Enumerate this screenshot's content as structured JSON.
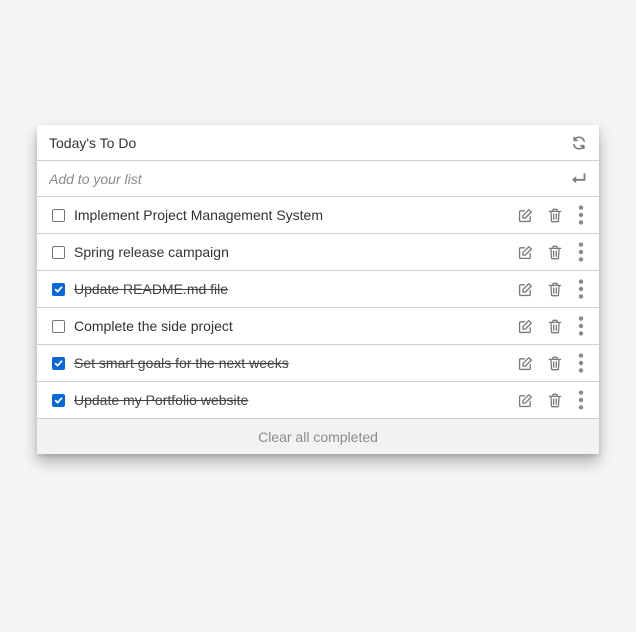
{
  "header": {
    "title": "Today's To Do",
    "refresh_icon": "refresh-icon"
  },
  "add_input": {
    "placeholder": "Add to your list",
    "value": "",
    "submit_icon": "enter-return-icon"
  },
  "items": [
    {
      "text": "Implement Project Management System",
      "completed": false
    },
    {
      "text": "Spring release campaign",
      "completed": false
    },
    {
      "text": "Update README.md file",
      "completed": true
    },
    {
      "text": "Complete the side project",
      "completed": false
    },
    {
      "text": "Set smart goals for the next weeks",
      "completed": true
    },
    {
      "text": "Update my Portfolio website",
      "completed": true
    }
  ],
  "item_action_icons": [
    "edit-icon",
    "trash-icon",
    "more-vertical-icon"
  ],
  "footer": {
    "clear_label": "Clear all completed"
  },
  "colors": {
    "background": "#f5f5f5",
    "card": "#ffffff",
    "checkbox_checked": "#0b67d6",
    "icon": "#7a7a7a",
    "footer_bg": "#f2f2f2"
  }
}
